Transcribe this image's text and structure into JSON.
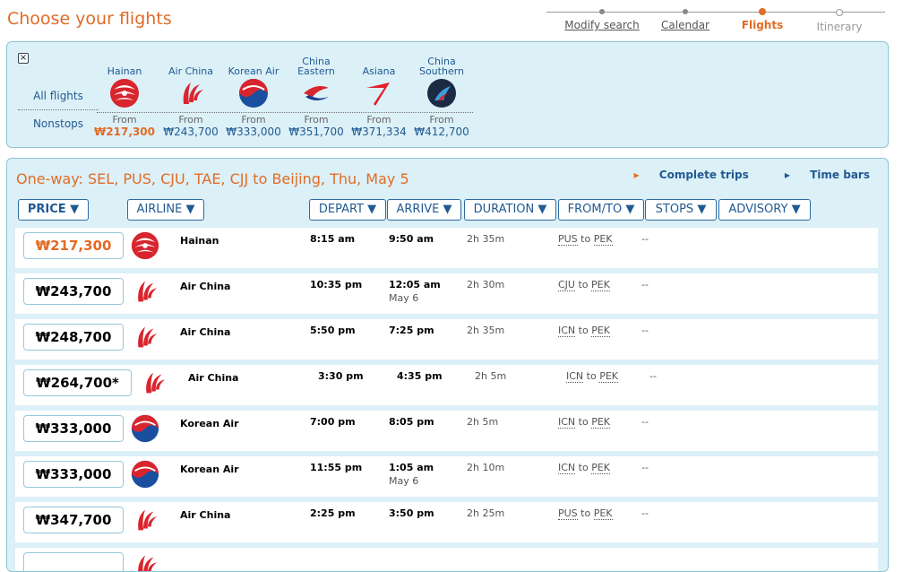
{
  "page_title": "Choose your flights",
  "steps": [
    {
      "label": "Modify search",
      "state": "done"
    },
    {
      "label": "Calendar",
      "state": "done"
    },
    {
      "label": "Flights",
      "state": "active"
    },
    {
      "label": "Itinerary",
      "state": "future"
    }
  ],
  "filter": {
    "close": "×",
    "all_flights": "All flights",
    "nonstops": "Nonstops",
    "from_label": "From",
    "airlines": [
      {
        "name": "Hainan",
        "price": "₩217,300",
        "icon": "hainan-logo-icon"
      },
      {
        "name": "Air China",
        "price": "₩243,700",
        "icon": "air-china-logo-icon"
      },
      {
        "name": "Korean Air",
        "price": "₩333,000",
        "icon": "korean-air-logo-icon"
      },
      {
        "name": "China Eastern",
        "price": "₩351,700",
        "icon": "china-eastern-logo-icon"
      },
      {
        "name": "Asiana",
        "price": "₩371,334",
        "icon": "asiana-logo-icon"
      },
      {
        "name": "China Southern",
        "price": "₩412,700",
        "icon": "china-southern-logo-icon"
      }
    ]
  },
  "results": {
    "route": "One-way: SEL, PUS, CJU, TAE, CJJ to Beijing, Thu, May 5",
    "complete_trips": "Complete trips",
    "time_bars": "Time bars",
    "headers": {
      "price": "PRICE ▼",
      "airline": "AIRLINE ▼",
      "depart": "DEPART ▼",
      "arrive": "ARRIVE ▼",
      "duration": "DURATION ▼",
      "fromto": "FROM/TO ▼",
      "stops": "STOPS ▼",
      "advisory": "ADVISORY ▼"
    },
    "to_word": "to",
    "rows": [
      {
        "price": "₩217,300",
        "airline": "Hainan",
        "depart": "8:15 am",
        "arrive": "9:50 am",
        "next_day": "",
        "duration": "2h 35m",
        "from": "PUS",
        "to": "PEK",
        "advisory": "--",
        "logo": "hainan"
      },
      {
        "price": "₩243,700",
        "airline": "Air China",
        "depart": "10:35 pm",
        "arrive": "12:05 am",
        "next_day": "May 6",
        "duration": "2h 30m",
        "from": "CJU",
        "to": "PEK",
        "advisory": "--",
        "logo": "airchina"
      },
      {
        "price": "₩248,700",
        "airline": "Air China",
        "depart": "5:50 pm",
        "arrive": "7:25 pm",
        "next_day": "",
        "duration": "2h 35m",
        "from": "ICN",
        "to": "PEK",
        "advisory": "--",
        "logo": "airchina"
      },
      {
        "price": "₩264,700*",
        "airline": "Air China",
        "depart": "3:30 pm",
        "arrive": "4:35 pm",
        "next_day": "",
        "duration": "2h 5m",
        "from": "ICN",
        "to": "PEK",
        "advisory": "--",
        "logo": "airchina"
      },
      {
        "price": "₩333,000",
        "airline": "Korean Air",
        "depart": "7:00 pm",
        "arrive": "8:05 pm",
        "next_day": "",
        "duration": "2h 5m",
        "from": "ICN",
        "to": "PEK",
        "advisory": "--",
        "logo": "korean"
      },
      {
        "price": "₩333,000",
        "airline": "Korean Air",
        "depart": "11:55 pm",
        "arrive": "1:05 am",
        "next_day": "May 6",
        "duration": "2h 10m",
        "from": "ICN",
        "to": "PEK",
        "advisory": "--",
        "logo": "korean"
      },
      {
        "price": "₩347,700",
        "airline": "Air China",
        "depart": "2:25 pm",
        "arrive": "3:50 pm",
        "next_day": "",
        "duration": "2h 25m",
        "from": "PUS",
        "to": "PEK",
        "advisory": "--",
        "logo": "airchina"
      },
      {
        "price": "",
        "airline": "",
        "depart": "",
        "arrive": "",
        "next_day": "",
        "duration": "",
        "from": "",
        "to": "",
        "advisory": "",
        "logo": "airchina"
      }
    ]
  }
}
